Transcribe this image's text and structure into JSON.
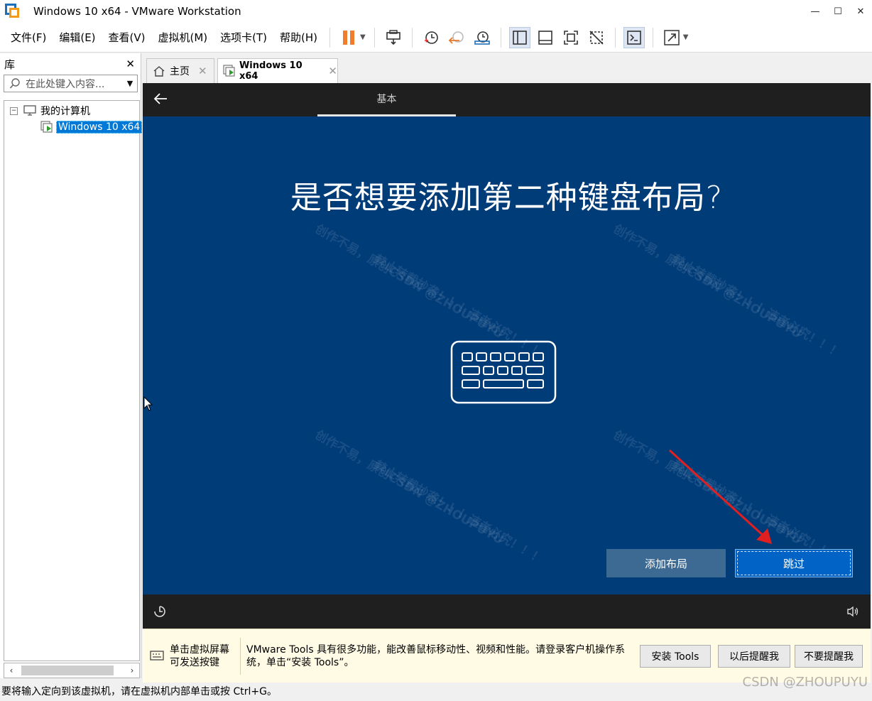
{
  "window": {
    "title": "Windows 10 x64 - VMware Workstation",
    "controls": [
      "—",
      "☐",
      "✕"
    ]
  },
  "menu": {
    "items": [
      "文件(F)",
      "编辑(E)",
      "查看(V)",
      "虚拟机(M)",
      "选项卡(T)",
      "帮助(H)"
    ]
  },
  "library": {
    "title": "库",
    "close": "✕",
    "search_placeholder": "在此处键入内容...",
    "tree": {
      "root_label": "我的计算机",
      "root_expander": "⊟",
      "vm_label": "Windows 10 x64"
    },
    "scroll_left": "‹",
    "scroll_right": "›"
  },
  "tabs": [
    {
      "label": "主页",
      "close": "✕"
    },
    {
      "label": "Windows 10 x64",
      "close": "✕"
    }
  ],
  "vm": {
    "step_label": "基本",
    "question": "是否想要添加第二种键盘布局?",
    "add_layout_button": "添加布局",
    "skip_button": "跳过",
    "watermark_line1": "创作不易，原创CSDN @ZHOUPUYU",
    "watermark_line2": "禁止转载抄袭！！！违者必究！！！"
  },
  "tools_bar": {
    "left_text": "单击虚拟屏幕可发送按键",
    "message": "VMware Tools 具有很多功能，能改善鼠标移动性、视频和性能。请登录客户机操作系统，单击“安装 Tools”。",
    "install_button": "安装 Tools",
    "remind_later_button": "以后提醒我",
    "never_remind_button": "不要提醒我"
  },
  "status_bar": {
    "text": "要将输入定向到该虚拟机，请在虚拟机内部单击或按 Ctrl+G。",
    "csdn_mark": "CSDN @ZHOUPUYU"
  },
  "colors": {
    "vm_background": "#003c78",
    "vm_bar": "#1f1f1f",
    "skip_button": "#0063c5",
    "add_button": "#3d6a93",
    "selection": "#0078d7",
    "tools_bar": "#fffbe5",
    "pause_orange": "#f07c2e"
  }
}
